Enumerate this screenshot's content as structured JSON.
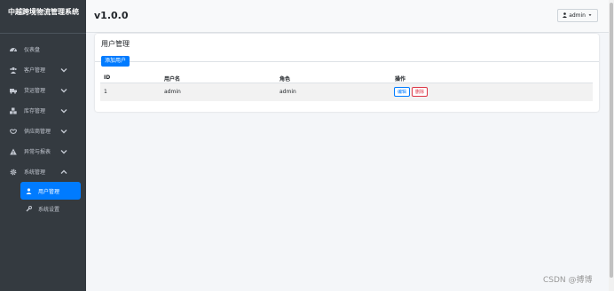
{
  "sidebar": {
    "brand": "中越跨境物流管理系统",
    "items": [
      {
        "label": "仪表盘",
        "icon": "dashboard-icon"
      },
      {
        "label": "客户管理",
        "icon": "users-icon"
      },
      {
        "label": "货运管理",
        "icon": "truck-icon"
      },
      {
        "label": "库存管理",
        "icon": "boxes-icon"
      },
      {
        "label": "供应商管理",
        "icon": "handshake-icon"
      },
      {
        "label": "异常与报表",
        "icon": "warning-icon"
      },
      {
        "label": "系统管理",
        "icon": "gear-icon"
      }
    ],
    "sub_items": [
      {
        "label": "用户管理",
        "icon": "user-icon"
      },
      {
        "label": "系统设置",
        "icon": "wrench-icon"
      }
    ]
  },
  "header": {
    "version": "v1.0.0",
    "user": "admin"
  },
  "card": {
    "title": "用户管理",
    "add_button": "添加用户"
  },
  "table": {
    "columns": [
      "ID",
      "用户名",
      "角色",
      "操作"
    ],
    "rows": [
      {
        "id": "1",
        "username": "admin",
        "role": "admin",
        "edit": "编辑",
        "delete": "删除"
      }
    ]
  },
  "watermark": "CSDN @搏博",
  "colors": {
    "accent": "#007bff",
    "danger": "#dc3545",
    "sidebar_bg": "#343a40"
  }
}
